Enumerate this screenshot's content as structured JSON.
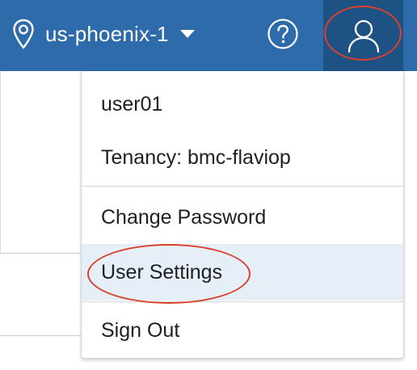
{
  "header": {
    "region": "us-phoenix-1",
    "region_icon": "location-pin-icon",
    "help_icon": "question-circle-icon",
    "user_icon": "user-icon"
  },
  "user_menu": {
    "username": "user01",
    "tenancy": "Tenancy: bmc-flaviop",
    "items": [
      {
        "label": "Change Password"
      },
      {
        "label": "User Settings"
      },
      {
        "label": "Sign Out"
      }
    ]
  },
  "colors": {
    "header_bg": "#2e6bab",
    "active_user_bg": "#1f5284",
    "highlight_bg": "#e6eef8",
    "annotation": "#d9412b"
  }
}
